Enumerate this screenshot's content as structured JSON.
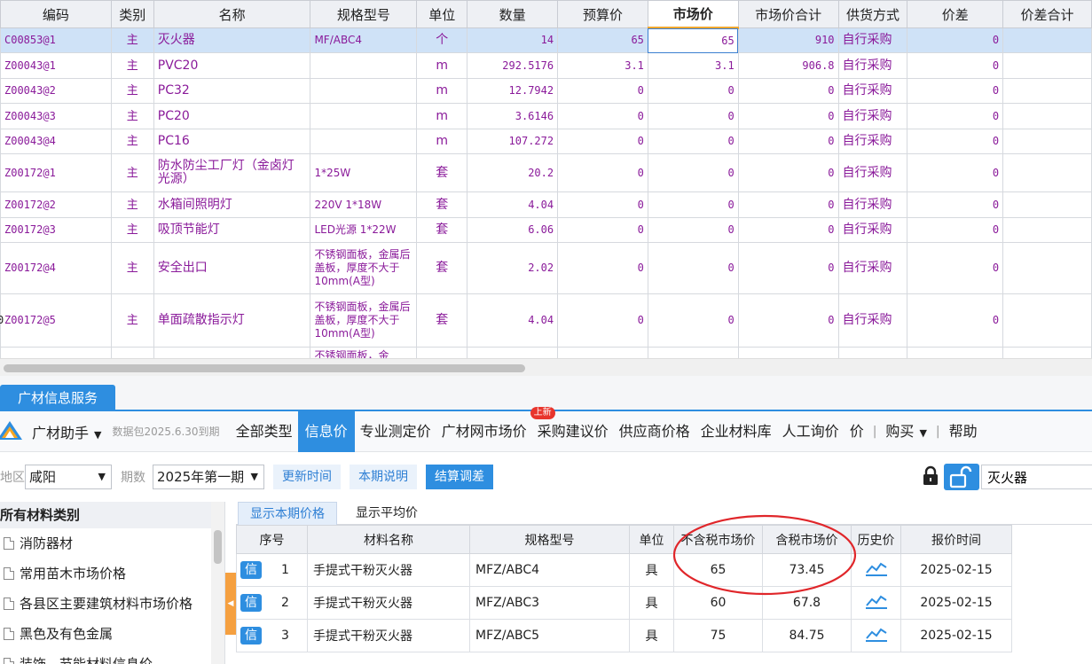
{
  "grid": {
    "columns": [
      "编码",
      "类别",
      "名称",
      "规格型号",
      "单位",
      "数量",
      "预算价",
      "市场价",
      "市场价合计",
      "供货方式",
      "价差",
      "价差合计"
    ],
    "active_column": "市场价",
    "rows": [
      {
        "code": "C00853@1",
        "type": "主",
        "name": "灭火器",
        "spec": "MF/ABC4",
        "unit": "个",
        "qty": "14",
        "budget": "65",
        "market": "65",
        "total": "910",
        "supply": "自行采购",
        "diff": "0",
        "diff_total": ""
      },
      {
        "code": "Z00043@1",
        "type": "主",
        "name": "PVC20",
        "spec": "",
        "unit": "m",
        "qty": "292.5176",
        "budget": "3.1",
        "market": "3.1",
        "total": "906.8",
        "supply": "自行采购",
        "diff": "0",
        "diff_total": ""
      },
      {
        "code": "Z00043@2",
        "type": "主",
        "name": "PC32",
        "spec": "",
        "unit": "m",
        "qty": "12.7942",
        "budget": "0",
        "market": "0",
        "total": "0",
        "supply": "自行采购",
        "diff": "0",
        "diff_total": ""
      },
      {
        "code": "Z00043@3",
        "type": "主",
        "name": "PC20",
        "spec": "",
        "unit": "m",
        "qty": "3.6146",
        "budget": "0",
        "market": "0",
        "total": "0",
        "supply": "自行采购",
        "diff": "0",
        "diff_total": ""
      },
      {
        "code": "Z00043@4",
        "type": "主",
        "name": "PC16",
        "spec": "",
        "unit": "m",
        "qty": "107.272",
        "budget": "0",
        "market": "0",
        "total": "0",
        "supply": "自行采购",
        "diff": "0",
        "diff_total": ""
      },
      {
        "code": "Z00172@1",
        "type": "主",
        "name": "防水防尘工厂灯（金卤灯光源）",
        "spec": "1*25W",
        "unit": "套",
        "qty": "20.2",
        "budget": "0",
        "market": "0",
        "total": "0",
        "supply": "自行采购",
        "diff": "0",
        "diff_total": ""
      },
      {
        "code": "Z00172@2",
        "type": "主",
        "name": "水箱间照明灯",
        "spec": "220V 1*18W",
        "unit": "套",
        "qty": "4.04",
        "budget": "0",
        "market": "0",
        "total": "0",
        "supply": "自行采购",
        "diff": "0",
        "diff_total": ""
      },
      {
        "code": "Z00172@3",
        "type": "主",
        "name": "吸顶节能灯",
        "spec": "LED光源 1*22W",
        "unit": "套",
        "qty": "6.06",
        "budget": "0",
        "market": "0",
        "total": "0",
        "supply": "自行采购",
        "diff": "0",
        "diff_total": ""
      },
      {
        "code": "Z00172@4",
        "type": "主",
        "name": "安全出口",
        "spec": "不锈钢面板，金属后盖板，厚度不大于10mm(A型)",
        "unit": "套",
        "qty": "2.02",
        "budget": "0",
        "market": "0",
        "total": "0",
        "supply": "自行采购",
        "diff": "0",
        "diff_total": ""
      },
      {
        "code": "Z00172@5",
        "type": "主",
        "name": "单面疏散指示灯",
        "spec": "不锈钢面板，金属后盖板，厚度不大于10mm(A型)",
        "unit": "套",
        "qty": "4.04",
        "budget": "0",
        "market": "0",
        "total": "0",
        "supply": "自行采购",
        "diff": "0",
        "diff_total": ""
      },
      {
        "code": "",
        "type": "",
        "name": "",
        "spec": "不锈钢面板，金",
        "unit": "",
        "qty": "",
        "budget": "",
        "market": "",
        "total": "",
        "supply": "",
        "diff": "",
        "diff_total": ""
      }
    ],
    "row_marker": "0"
  },
  "panel": {
    "tab": "广材信息服务",
    "assistant": "广材助手",
    "package": "数据包2025.6.30到期",
    "nav": [
      "全部类型",
      "信息价",
      "专业测定价",
      "广材网市场价",
      "采购建议价",
      "供应商价格",
      "企业材料库",
      "人工询价",
      "价"
    ],
    "nav_active": "信息价",
    "new_badge": "上新",
    "buy": "购买",
    "help": "帮助"
  },
  "filter": {
    "region_label": "地区",
    "region": "咸阳",
    "period_label": "期数",
    "period": "2025年第一期",
    "update_time": "更新时间",
    "notes": "本期说明",
    "settle": "结算调差",
    "search_value": "灭火器"
  },
  "tree": {
    "header": "所有材料类别",
    "items": [
      "消防器材",
      "常用苗木市场价格",
      "各县区主要建筑材料市场价格",
      "黑色及有色金属",
      "装饰、节能材料信息价"
    ]
  },
  "price_tabs": [
    "显示本期价格",
    "显示平均价"
  ],
  "price_table": {
    "columns": [
      "序号",
      "材料名称",
      "规格型号",
      "单位",
      "不含税市场价",
      "含税市场价",
      "历史价",
      "报价时间"
    ],
    "tag": "信",
    "rows": [
      {
        "no": "1",
        "name": "手提式干粉灭火器",
        "spec": "MFZ/ABC4",
        "unit": "具",
        "price_ex": "65",
        "price_in": "73.45",
        "date": "2025-02-15"
      },
      {
        "no": "2",
        "name": "手提式干粉灭火器",
        "spec": "MFZ/ABC3",
        "unit": "具",
        "price_ex": "60",
        "price_in": "67.8",
        "date": "2025-02-15"
      },
      {
        "no": "3",
        "name": "手提式干粉灭火器",
        "spec": "MFZ/ABC5",
        "unit": "具",
        "price_ex": "75",
        "price_in": "84.75",
        "date": "2025-02-15"
      }
    ]
  },
  "colors": {
    "accent": "#2e8ee0",
    "annotation": "#e0262a",
    "grid_text": "#8a1a9a"
  }
}
